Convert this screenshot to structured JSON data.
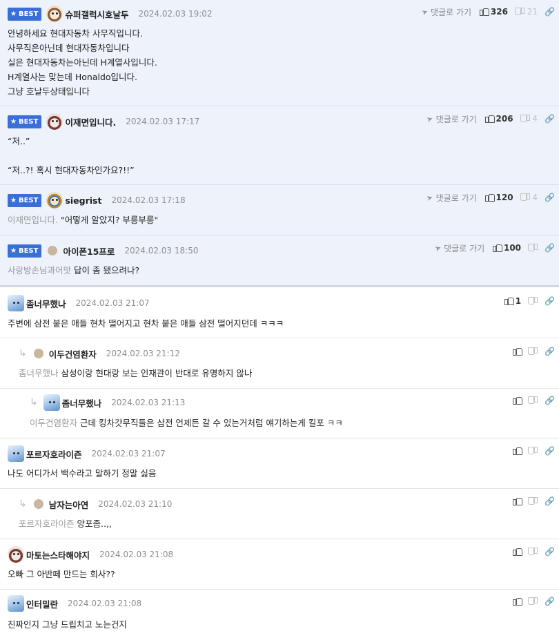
{
  "labels": {
    "best": "BEST",
    "reply_to": "댓글로 가기",
    "star": "★",
    "reply_arrow": "↳",
    "plane": "➤",
    "link": "🔗"
  },
  "icons": {
    "star": "star-icon",
    "reply_to": "send-icon",
    "upvote": "thumbs-up-icon",
    "downvote": "thumbs-down-icon",
    "link": "link-icon",
    "reply_arrow": "reply-arrow-icon"
  },
  "colors": {
    "best_bg": "#edf2fb",
    "badge": "#3b6fd8"
  },
  "best_comments": [
    {
      "nickname": "슈퍼갤럭시호날두",
      "date": "2024.02.03 19:02",
      "up": "326",
      "down": "21",
      "lines": [
        "안녕하세요 현대자동차 사무직입니다.",
        "사무직은아닌데 현대자동차입니다",
        "실은 현대자동차는아닌데 H계열사입니다.",
        "H계열사는 맞는데 Honaldo입니다.",
        "그냥 호날두상태입니다"
      ]
    },
    {
      "nickname": "이재면입니다.",
      "date": "2024.02.03 17:17",
      "up": "206",
      "down": "4",
      "lines": [
        "“저..”",
        "",
        "“저..?! 혹시 현대자동차인가요?!!”"
      ]
    },
    {
      "nickname": "siegrist",
      "date": "2024.02.03 17:18",
      "up": "120",
      "down": "4",
      "mention": "이재면입니다.",
      "text": "\"어떻게 알았지? 부릉부릉\""
    },
    {
      "nickname": "아이폰15프로",
      "date": "2024.02.03 18:50",
      "up": "100",
      "mention": "사랑방손님과어맛",
      "text": "답이 좀 됐으려나?"
    }
  ],
  "comments": [
    {
      "nickname": "좀너무했나",
      "date": "2024.02.03 21:07",
      "up": "1",
      "text": "주변에 삼전 붙은 애들 현차 떨어지고 현차 붙은 애들 삼전 떨어지던데 ㅋㅋㅋ"
    },
    {
      "nickname": "이두건염환자",
      "date": "2024.02.03 21:12",
      "mention": "좀너무했나",
      "text": "삼성이랑 현대랑 보는 인재관이 반대로 유명하지 않나"
    },
    {
      "nickname": "좀너무했나",
      "date": "2024.02.03 21:13",
      "mention": "이두건염환자",
      "text": "근데 킹차갓무직들은 삼전 언제든 갈 수 있는거처럼 얘기하는게 킬포 ㅋㅋ"
    },
    {
      "nickname": "포르자호라이즌",
      "date": "2024.02.03 21:07",
      "text": "나도 어디가서 백수라고 말하기 정말 싫음"
    },
    {
      "nickname": "남자는아연",
      "date": "2024.02.03 21:10",
      "mention": "포르자호라이즌",
      "text": "앙포좀..,,"
    },
    {
      "nickname": "마토는스타해야지",
      "date": "2024.02.03 21:08",
      "text": "오빠 그 아반떼 만드는 회사??"
    },
    {
      "nickname": "인터밀란",
      "date": "2024.02.03 21:08",
      "text": "진짜인지 그냥 드립치고 노는건지"
    }
  ]
}
